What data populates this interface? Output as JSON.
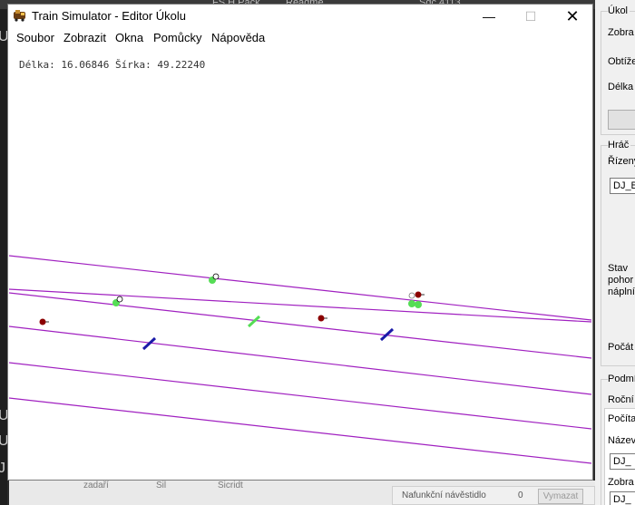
{
  "background": {
    "top_fragments": [
      "FS H Pack",
      "Readme",
      "Sdc 4113"
    ],
    "left_fragments": [
      "U",
      "U",
      "U",
      "J"
    ],
    "bottom_fragments": [
      "zadaří",
      "Sil",
      "Sicridt"
    ]
  },
  "window": {
    "title": "Train Simulator - Editor Úkolu",
    "buttons": {
      "minimize": "—",
      "maximize": "☐",
      "close": "✕"
    }
  },
  "menu": [
    "Soubor",
    "Zobrazit",
    "Okna",
    "Pomůcky",
    "Nápověda"
  ],
  "coords": "Délka: 16.06846 Šírka: 49.22240",
  "side_panel": {
    "group1_title": "Úkol",
    "zobra": "Zobra",
    "obtize": "Obtíže",
    "delka": "Délka",
    "group2_title": "Hráč",
    "rizeny": "Řízený",
    "player_value": "DJ_B",
    "stav": "Stav",
    "pohon": "pohor",
    "naplni": "náplní",
    "pocat": "Počát",
    "group3_title": "Podmí",
    "rocni": "Roční",
    "pocita_header": "Počíta",
    "nazev": "Název",
    "value2": "DJ_",
    "zobra2": "Zobra",
    "value3": "DJ_"
  },
  "bottom_right": {
    "label": "Nafunkční návěstidlo",
    "count": "0",
    "button": "Vymazat"
  },
  "colors": {
    "track": "#a020c0",
    "signal_red": "#8b0000",
    "marker_green": "#55dd55",
    "marker_blue": "#1a1aa8"
  }
}
